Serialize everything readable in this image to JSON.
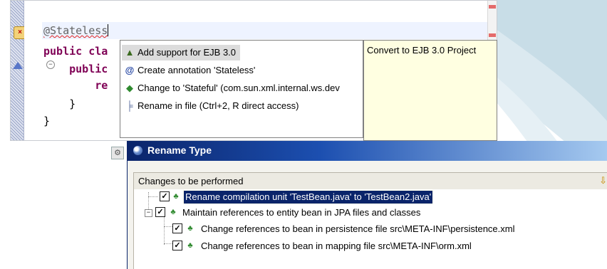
{
  "editor": {
    "line1_annotation": "@Stateless",
    "line2_kw": "public",
    "line2_rest": " cla",
    "line3_kw": "public",
    "line4_text": "re",
    "line5_text": "}",
    "line6_text": "}",
    "error_marker_icon": "error-lightbulb-icon",
    "override_icon": "override-arrow-icon"
  },
  "quick_assist": {
    "proposals": [
      {
        "label": "Add support for EJB 3.0",
        "icon": "ejb-support-icon",
        "selected": true
      },
      {
        "label": "Create annotation 'Stateless'",
        "icon": "annotation-icon",
        "selected": false
      },
      {
        "label": "Change to 'Stateful' (com.sun.xml.internal.ws.dev",
        "icon": "change-icon",
        "selected": false
      },
      {
        "label": "Rename in file (Ctrl+2, R direct access)",
        "icon": "rename-icon",
        "selected": false
      }
    ],
    "info_text": "Convert to EJB 3.0 Project"
  },
  "dialog": {
    "title": "Rename Type",
    "changes_label": "Changes to be performed",
    "tree": [
      {
        "text": "Rename compilation unit 'TestBean.java' to 'TestBean2.java'",
        "checked": true,
        "selected": true,
        "level": 0
      },
      {
        "text": "Maintain references to entity bean in JPA files and classes",
        "checked": true,
        "selected": false,
        "level": 0
      },
      {
        "text": "Change references to bean in persistence file src\\META-INF\\persistence.xml",
        "checked": true,
        "selected": false,
        "level": 1
      },
      {
        "text": "Change references to bean in mapping file src\\META-INF\\orm.xml",
        "checked": true,
        "selected": false,
        "level": 1
      }
    ]
  },
  "colors": {
    "keyword": "#7f0055",
    "annotation": "#646464",
    "selection": "#0a246a",
    "tooltip_bg": "#ffffe1"
  }
}
